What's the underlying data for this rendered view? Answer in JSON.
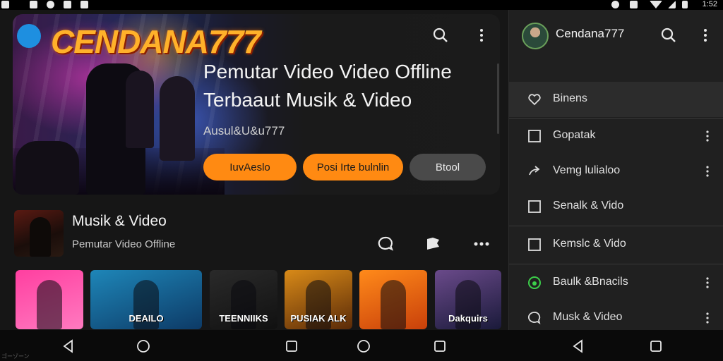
{
  "status_bar": {
    "time": "1:52"
  },
  "hero": {
    "logo_badge": "",
    "brand": "CENDANA777",
    "headline": "Pemutar Video Video Offline Terbaaut Musik & Video",
    "subtitle": "Ausul&U&u777",
    "buttons": [
      {
        "label": "IuvAeslo"
      },
      {
        "label": "Posi Irte bulnlin"
      },
      {
        "label": "Btool"
      }
    ]
  },
  "list_item": {
    "title": "Musik & Video",
    "subtitle": "Pemutar Video Offline"
  },
  "cards": [
    {
      "label": "",
      "colors": [
        "#ff3fa0",
        "#ff7ac0"
      ]
    },
    {
      "label": "DEAILO",
      "colors": [
        "#1e86b8",
        "#0d3a66"
      ]
    },
    {
      "label": "TEENNIIKS",
      "colors": [
        "#2a2a2a",
        "#111111"
      ]
    },
    {
      "label": "PUSIAK ALK",
      "colors": [
        "#d88a18",
        "#5a2a08"
      ]
    },
    {
      "label": "",
      "colors": [
        "#ff8a1a",
        "#c9400a"
      ]
    },
    {
      "label": "Dakquirs",
      "colors": [
        "#6a4a8a",
        "#1a1a3a"
      ]
    }
  ],
  "panel": {
    "username": "Cendana777",
    "items": [
      {
        "label": "Binens",
        "icon": "heart-outline-icon",
        "active": true,
        "more": false
      },
      {
        "label": "Gopatak",
        "icon": "square-icon",
        "active": false,
        "more": true
      },
      {
        "label": "Vemg lulialoo",
        "icon": "share-icon",
        "active": false,
        "more": true
      },
      {
        "label": "Senalk & Vido",
        "icon": "square-icon",
        "active": false,
        "more": false
      },
      {
        "label": "Kemslc & Vido",
        "icon": "square-icon",
        "active": false,
        "more": false
      },
      {
        "label": "Baulk &Bnacils",
        "icon": "music-circle-icon",
        "active": false,
        "more": true
      },
      {
        "label": "Musk & Video",
        "icon": "chat-icon",
        "active": false,
        "more": true
      }
    ]
  },
  "colors": {
    "accent": "#ff8a12",
    "panel": "#202020",
    "background": "#161616"
  },
  "watermark": "ゴーゾーン"
}
